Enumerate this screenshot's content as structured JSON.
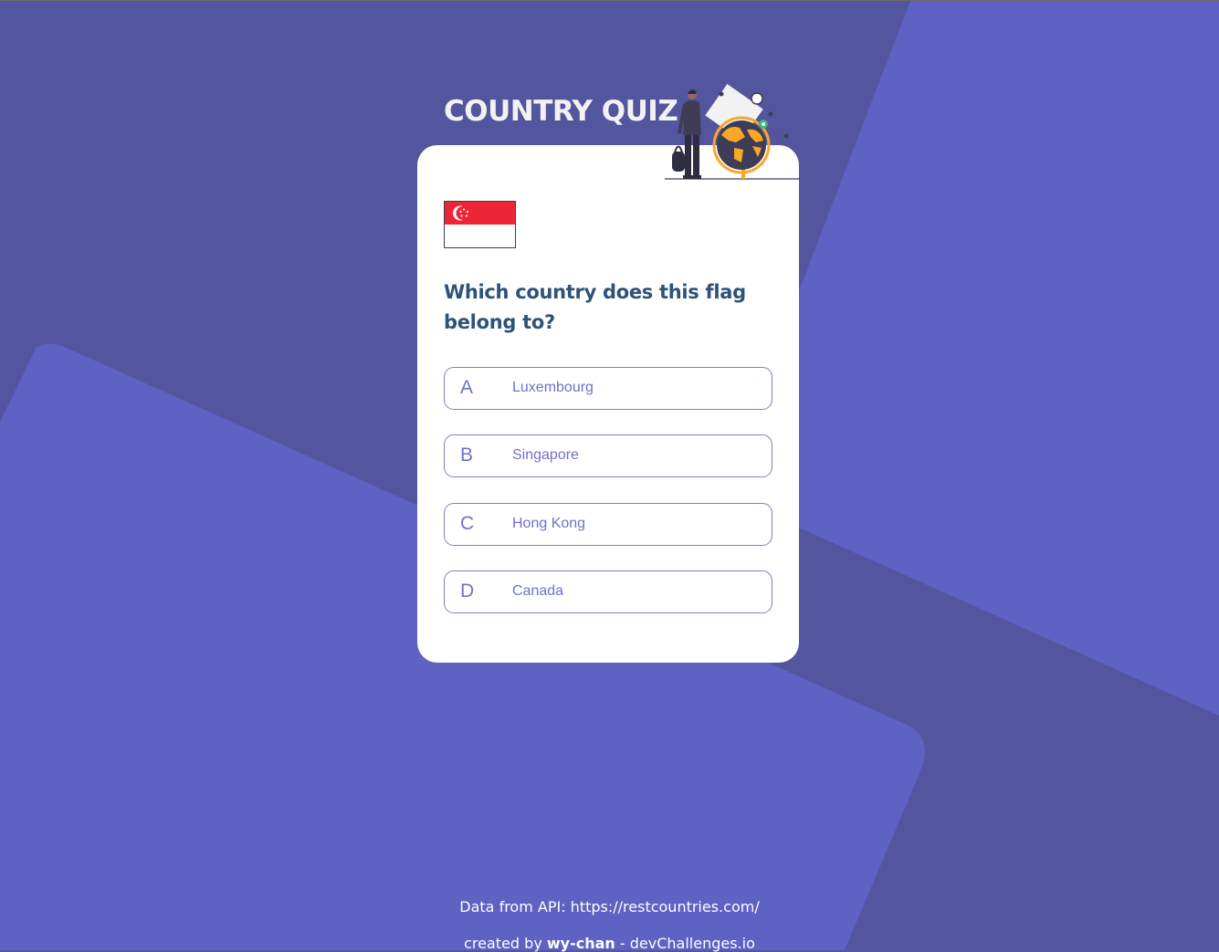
{
  "app": {
    "title": "COUNTRY QUIZ",
    "colors": {
      "background": "#53559e",
      "shape": "#5d62c3",
      "card": "#ffffff",
      "question": "#2f527b",
      "option": "#6f72c9",
      "flag_red": "#ee2536"
    }
  },
  "illustration": {
    "icon": "traveler-with-globe-icon"
  },
  "question": {
    "flag_icon": "singapore-flag-icon",
    "text": "Which country does this flag belong to?"
  },
  "options": [
    {
      "letter": "A",
      "answer": "Luxembourg"
    },
    {
      "letter": "B",
      "answer": "Singapore"
    },
    {
      "letter": "C",
      "answer": "Hong Kong"
    },
    {
      "letter": "D",
      "answer": "Canada"
    }
  ],
  "footer": {
    "api_text": "Data from API: https://restcountries.com/",
    "credit_prefix": "created by",
    "credit_author": "wy-chan",
    "credit_suffix": "- devChallenges.io"
  }
}
